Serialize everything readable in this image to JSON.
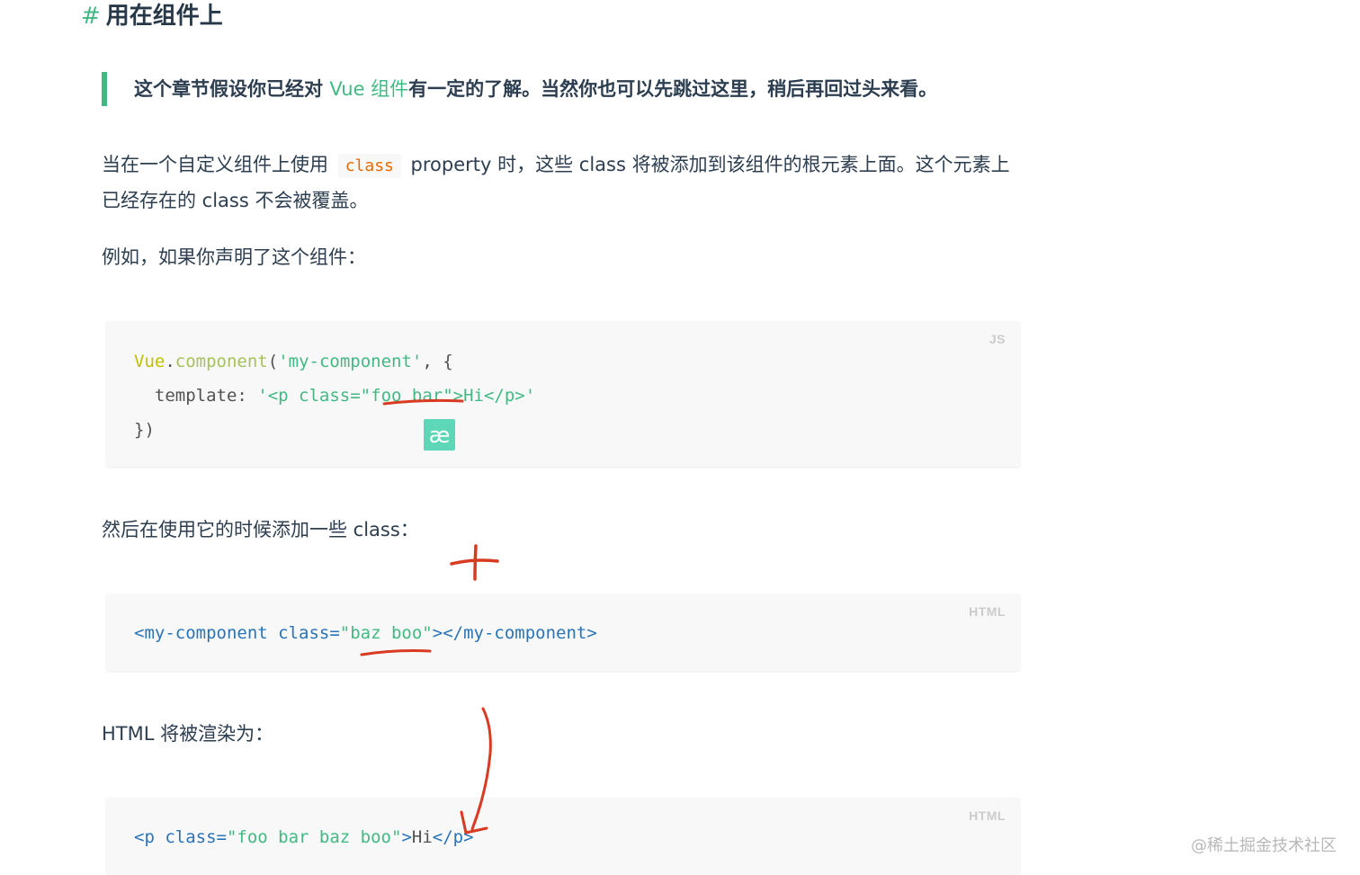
{
  "heading": {
    "hash": "#",
    "title": "用在组件上"
  },
  "tip": {
    "before": "这个章节假设你已经对 ",
    "link": "Vue 组件",
    "after": "有一定的了解。当然你也可以先跳过这里，稍后再回过头来看。"
  },
  "para1": {
    "before": "当在一个自定义组件上使用 ",
    "code": "class",
    "after": " property 时，这些 class 将被添加到该组件的根元素上面。这个元素上已经存在的 class 不会被覆盖。"
  },
  "para2": "例如，如果你声明了这个组件：",
  "code1": {
    "lang": "JS",
    "l1_vue": "Vue",
    "l1_dot": ".",
    "l1_fn": "component",
    "l1_open": "(",
    "l1_str": "'my-component'",
    "l1_end": ", {",
    "l2_key": "  template: ",
    "l2_str_a": "'<p class=\"",
    "l2_str_b": "foo bar",
    "l2_str_c": "\">Hi</p>'",
    "l3": "})"
  },
  "ae_badge": "æ",
  "para3": "然后在使用它的时候添加一些 class：",
  "code2": {
    "lang": "HTML",
    "tag_open": "<my-component",
    "attr": " class=",
    "val": "\"baz boo\"",
    "tag_close": "></my-component>"
  },
  "para4": "HTML 将被渲染为：",
  "code3": {
    "lang": "HTML",
    "tag_open": "<p",
    "attr": " class=",
    "val": "\"foo bar baz boo\"",
    "gt": ">",
    "text": "Hi",
    "tag_close": "</p>"
  },
  "watermark": "@稀土掘金技术社区",
  "colors": {
    "accent": "#42b983",
    "annotation": "#d93a22"
  }
}
